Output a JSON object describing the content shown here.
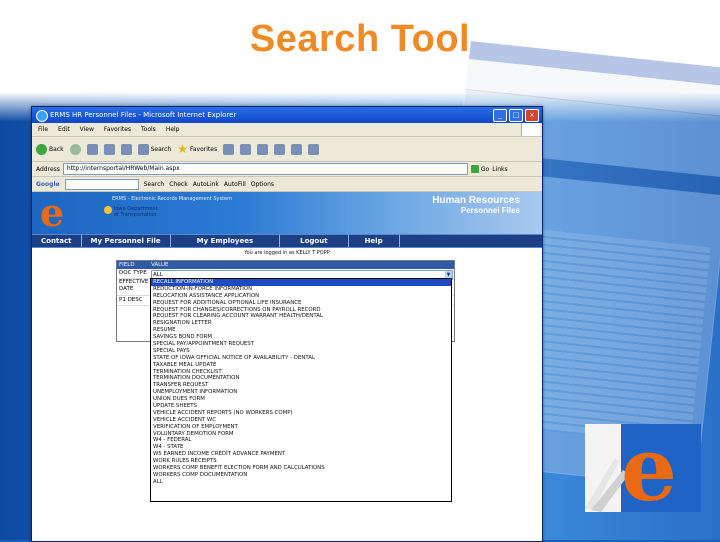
{
  "slide": {
    "title": "Search Tool",
    "title_color": "#f08a24"
  },
  "browser": {
    "window_title": "ERMS HR Personnel Files - Microsoft Internet Explorer",
    "menu": [
      "File",
      "Edit",
      "View",
      "Favorites",
      "Tools",
      "Help"
    ],
    "toolbar": {
      "back_label": "Back",
      "search_label": "Search",
      "favorites_label": "Favorites"
    },
    "address_label": "Address",
    "address_url": "http://internsportal/HRWeb/Main.aspx",
    "go_label": "Go",
    "links_label": "Links",
    "google_toolbar": {
      "brand": "Google",
      "search_label": "Search",
      "check_label": "Check",
      "autolink_label": "AutoLink",
      "autofill_label": "AutoFill",
      "options_label": "Options"
    }
  },
  "site": {
    "logo_letter": "e",
    "logo_subtitle": "ERMS - Electronic Records Management System",
    "dept_name": "Iowa Department of Transportation",
    "header_line1": "Human Resources",
    "header_line2": "Personnel Files",
    "nav": [
      "Contact",
      "My Personnel File",
      "My Employees",
      "Logout",
      "Help"
    ],
    "logged_in": "You are logged in as KELLY T POPP"
  },
  "search_panel": {
    "header_field": "FIELD",
    "header_value": "VALUE",
    "rows": [
      "DOC TYPE",
      "EFFECTIVE DATE",
      "P1 DESC"
    ],
    "doc_type_value": "ALL",
    "dropdown_arrow": "▼",
    "options": [
      "RECALL INFORMATION",
      "REDUCTION-IN-FORCE INFORMATION",
      "RELOCATION ASSISTANCE APPLICATION",
      "REQUEST FOR ADDITIONAL OPTIONAL LIFE INSURANCE",
      "REQUEST FOR CHANGES/CORRECTIONS ON PAYROLL RECORD",
      "REQUEST FOR CLEARING ACCOUNT WARRANT HEALTH/DENTAL",
      "RESIGNATION LETTER",
      "RESUME",
      "SAVINGS BOND FORM",
      "SPECIAL PAY/APPOINTMENT REQUEST",
      "SPECIAL PAYS",
      "STATE OF IOWA OFFICIAL NOTICE OF AVAILABILITY - DENTAL",
      "TAXABLE MEAL UPDATE",
      "TERMINATION CHECKLIST",
      "TERMINATION DOCUMENTATION",
      "TRANSFER REQUEST",
      "UNEMPLOYMENT INFORMATION",
      "UNION DUES FORM",
      "UPDATE SHEETS",
      "VEHICLE ACCIDENT REPORTS (NO WORKERS COMP)",
      "VEHICLE ACCIDENT WC",
      "VERIFICATION OF EMPLOYMENT",
      "VOLUNTARY DEMOTION FORM",
      "W4 - FEDERAL",
      "W4 - STATE",
      "W5 EARNED INCOME CREDIT ADVANCE PAYMENT",
      "WORK RULES RECEIPTS",
      "WORKERS COMP BENEFIT ELECTION FORM AND CALCULATIONS",
      "WORKERS COMP DOCUMENTATION",
      "ALL"
    ],
    "selected_index": 0
  }
}
